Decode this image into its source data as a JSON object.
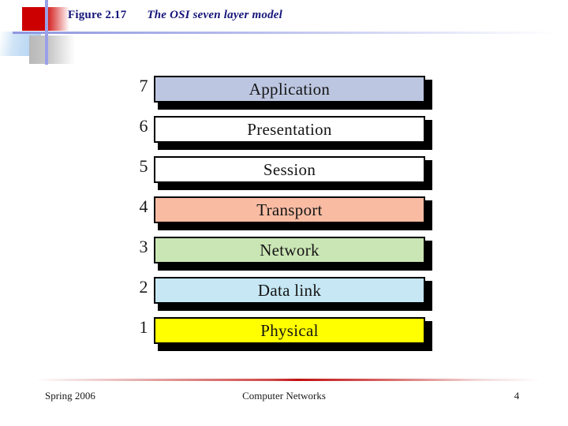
{
  "slide": {
    "title": {
      "figure_label": "Figure 2.17",
      "caption": "The OSI seven layer model",
      "color": "#15157a"
    },
    "decoration": {
      "red_square": "red-square",
      "blue_square": "blue-gradient-square",
      "gray_square": "gray-gradient-square",
      "horizontal_rule": "blue-horizontal-line",
      "vertical_rule": "blue-vertical-line",
      "red_accent": "#cc0000",
      "blue_accent": "#9aa0e8"
    },
    "diagram": {
      "name": "osi-seven-layer-model",
      "layers": [
        {
          "number": "7",
          "label": "Application",
          "color": "#bcc6e0"
        },
        {
          "number": "6",
          "label": "Presentation",
          "color": "#ffffff"
        },
        {
          "number": "5",
          "label": "Session",
          "color": "#ffffff"
        },
        {
          "number": "4",
          "label": "Transport",
          "color": "#f9bca3"
        },
        {
          "number": "3",
          "label": "Network",
          "color": "#cbe6b5"
        },
        {
          "number": "2",
          "label": "Data link",
          "color": "#c6e7f3"
        },
        {
          "number": "1",
          "label": "Physical",
          "color": "#ffff00"
        }
      ]
    },
    "footer": {
      "left": "Spring 2006",
      "center": "Computer Networks",
      "page": "4",
      "rule_color": "#c21010"
    }
  }
}
